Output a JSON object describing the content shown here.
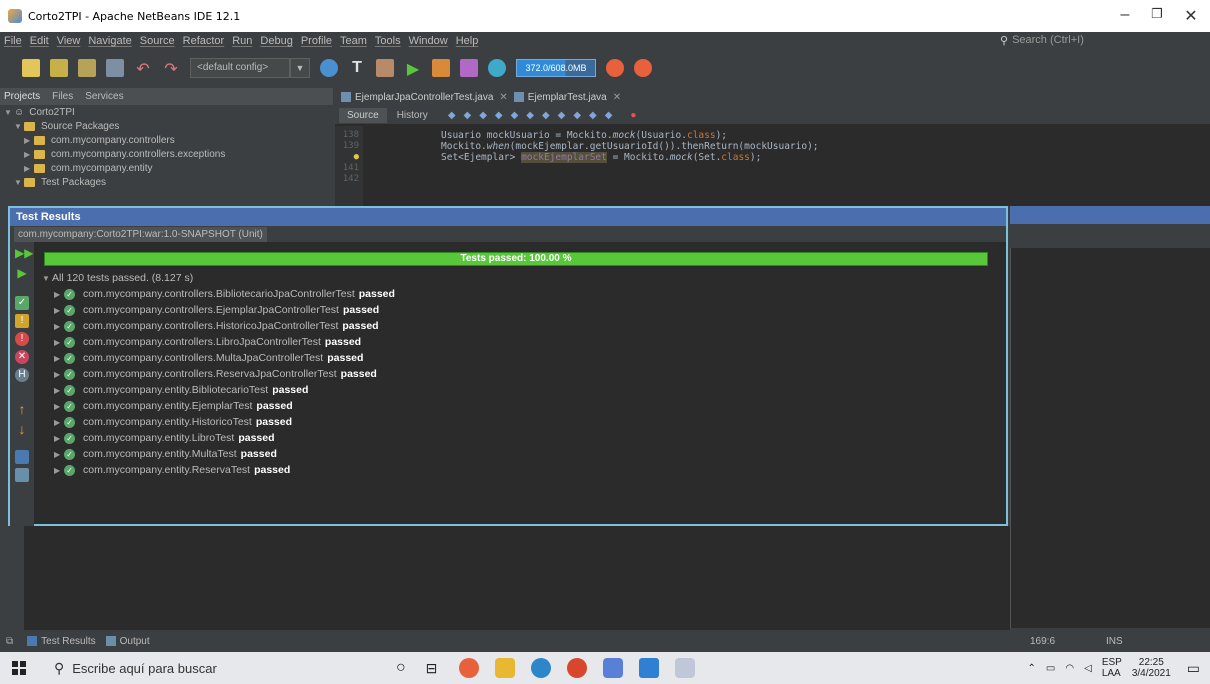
{
  "window": {
    "title": "Corto2TPI - Apache NetBeans IDE 12.1"
  },
  "menu": [
    "File",
    "Edit",
    "View",
    "Navigate",
    "Source",
    "Refactor",
    "Run",
    "Debug",
    "Profile",
    "Team",
    "Tools",
    "Window",
    "Help"
  ],
  "search": {
    "placeholder": "Search (Ctrl+I)"
  },
  "toolbar": {
    "config": "<default config>",
    "memory": "372.0/608.0MB"
  },
  "projects": {
    "tabs": [
      "Projects",
      "Files",
      "Services"
    ],
    "root": "Corto2TPI",
    "items": [
      "Source Packages",
      "com.mycompany.controllers",
      "com.mycompany.controllers.exceptions",
      "com.mycompany.entity",
      "Test Packages"
    ]
  },
  "editor": {
    "tabs": [
      "EjemplarJpaControllerTest.java",
      "EjemplarTest.java"
    ],
    "source_label": "Source",
    "history_label": "History",
    "line_numbers": [
      "138",
      "139",
      "",
      "141",
      "142"
    ]
  },
  "test_results": {
    "title": "Test Results",
    "subtab": "com.mycompany:Corto2TPI:war:1.0-SNAPSHOT (Unit)",
    "progress_label": "Tests passed: 100.00 %",
    "progress_fraction": 1.0,
    "summary": "All 120 tests passed. (8.127 s)",
    "passed_label": "passed",
    "tests": [
      "com.mycompany.controllers.BibliotecarioJpaControllerTest",
      "com.mycompany.controllers.EjemplarJpaControllerTest",
      "com.mycompany.controllers.HistoricoJpaControllerTest",
      "com.mycompany.controllers.LibroJpaControllerTest",
      "com.mycompany.controllers.MultaJpaControllerTest",
      "com.mycompany.controllers.ReservaJpaControllerTest",
      "com.mycompany.entity.BibliotecarioTest",
      "com.mycompany.entity.EjemplarTest",
      "com.mycompany.entity.HistoricoTest",
      "com.mycompany.entity.LibroTest",
      "com.mycompany.entity.MultaTest",
      "com.mycompany.entity.ReservaTest"
    ]
  },
  "statusbar": {
    "tab1": "Test Results",
    "tab2": "Output",
    "position": "169:6",
    "mode": "INS"
  },
  "taskbar": {
    "search": "Escribe aquí para buscar",
    "lang": "ESP",
    "layout": "LAA",
    "time": "22:25",
    "date": "3/4/2021"
  },
  "colors": {
    "accent": "#4b6eaf",
    "progress": "#59c73a",
    "highlight_border": "#7cc0de"
  }
}
